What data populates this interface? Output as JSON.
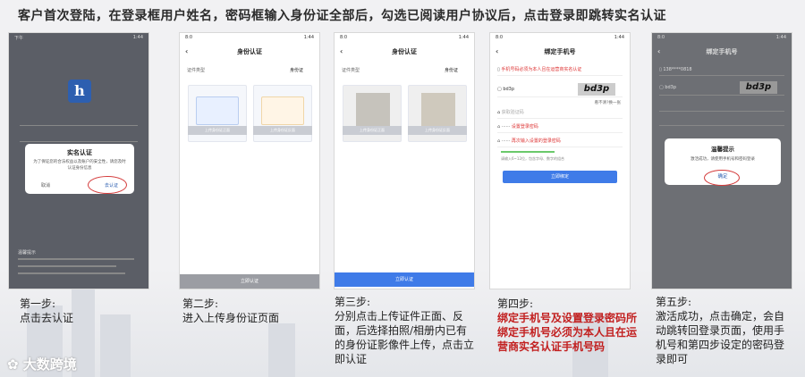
{
  "title": "客户首次登陆，在登录框用户姓名，密码框输入身份证全部后，勾选已阅读用户协议后，点击登录即跳转实名认证",
  "watermark": "大数跨境",
  "steps": [
    {
      "heading": "第一步:",
      "body": "点击去认证"
    },
    {
      "heading": "第二步:",
      "body": "进入上传身份证页面"
    },
    {
      "heading": "第三步:",
      "body": "分别点击上传证件正面、反面，后选择拍照/相册内已有的身份证影像件上传，点击立即认证"
    },
    {
      "heading": "第四步:",
      "body": "绑定手机号及设置登录密码所绑定手机号必须为本人且在运营商实名认证手机号码"
    },
    {
      "heading": "第五步:",
      "body": "激活成功，点击确定，会自动跳转回登录页面，使用手机号和第四步设定的密码登录即可"
    }
  ],
  "phone1": {
    "status_time": "下午",
    "status_right": "1:44",
    "modal_title": "实名认证",
    "modal_text": "为了保证您的合法权益以及账户的安全性，请您及时认证身份信息",
    "cancel": "取消",
    "confirm": "去认证",
    "footer_title": "温馨提示"
  },
  "phone2": {
    "status_time": "8:0",
    "status_right": "1:44",
    "nav_title": "身份认证",
    "type_label": "证件类型",
    "type_value": "身份证",
    "front_btn": "上传身份证正面",
    "back_btn": "上传身份证反面",
    "submit": "立即认证"
  },
  "phone3": {
    "status_time": "8:0",
    "status_right": "1:44",
    "nav_title": "身份认证",
    "type_label": "证件类型",
    "type_value": "身份证",
    "front_btn": "上传身份证正面",
    "back_btn": "上传身份证反面",
    "submit": "立即认证"
  },
  "phone4": {
    "status_time": "8:0",
    "status_right": "1:44",
    "nav_title": "绑定手机号",
    "phone_hint": "手机号码必须为本人且在运营商实名认证",
    "code_input": "bd3p",
    "captcha": "bd3p",
    "refresh": "看不清?换一张",
    "sms_label": "获取验证码",
    "pwd1": "设置登录密码",
    "pwd2": "再次输入设置的登录密码",
    "rule": "请输入6~12位，包含字母、数字的组合",
    "submit": "立即绑定"
  },
  "phone5": {
    "status_time": "8:0",
    "status_right": "1:44",
    "nav_title": "绑定手机号",
    "phone_value": "138****0818",
    "code_input": "bd3p",
    "captcha": "bd3p",
    "modal_title": "温馨提示",
    "modal_text": "激活成功，请使用手机号和密码登录",
    "confirm": "确定"
  }
}
